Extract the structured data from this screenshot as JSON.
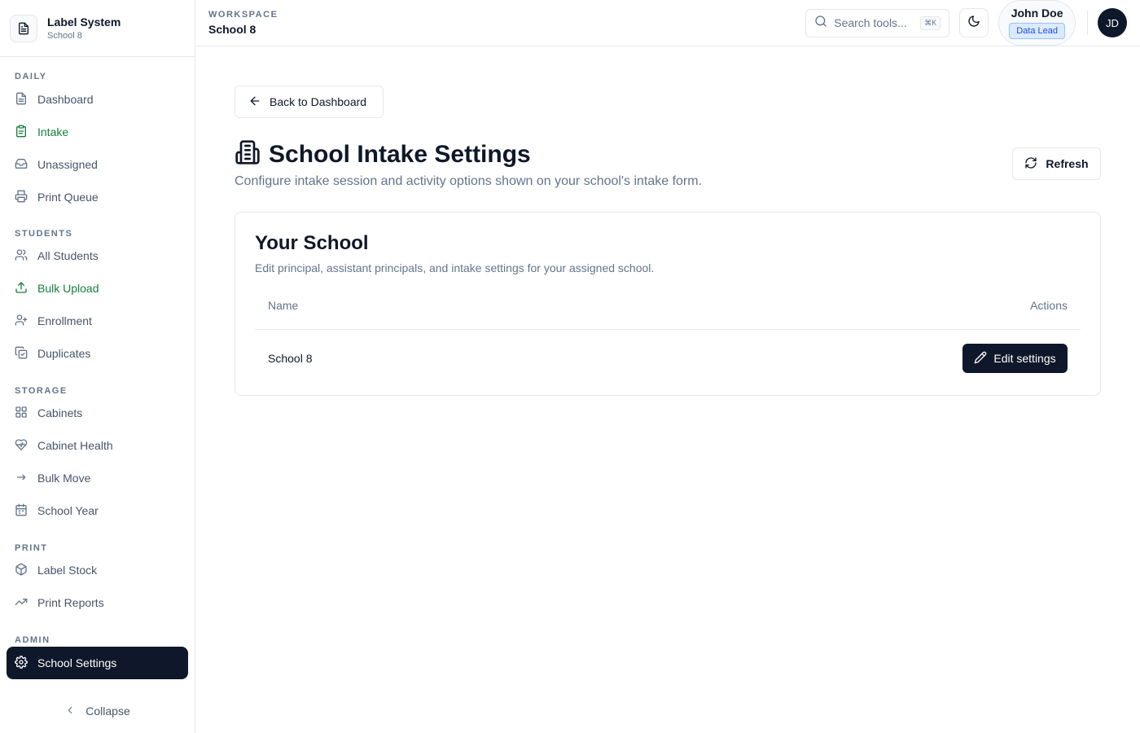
{
  "brand": {
    "title": "Label System",
    "subtitle": "School 8"
  },
  "nav": {
    "sections": [
      {
        "label": "DAILY",
        "items": [
          {
            "label": "Dashboard",
            "icon": "file-icon"
          },
          {
            "label": "Intake",
            "icon": "clipboard-icon"
          },
          {
            "label": "Unassigned",
            "icon": "inbox-icon"
          },
          {
            "label": "Print Queue",
            "icon": "printer-icon"
          }
        ]
      },
      {
        "label": "STUDENTS",
        "items": [
          {
            "label": "All Students",
            "icon": "users-icon"
          },
          {
            "label": "Bulk Upload",
            "icon": "upload-icon"
          },
          {
            "label": "Enrollment",
            "icon": "user-plus-icon"
          },
          {
            "label": "Duplicates",
            "icon": "copy-check-icon"
          }
        ]
      },
      {
        "label": "STORAGE",
        "items": [
          {
            "label": "Cabinets",
            "icon": "grid-icon"
          },
          {
            "label": "Cabinet Health",
            "icon": "heart-pulse-icon"
          },
          {
            "label": "Bulk Move",
            "icon": "arrow-right-icon"
          },
          {
            "label": "School Year",
            "icon": "calendar-icon"
          }
        ]
      },
      {
        "label": "PRINT",
        "items": [
          {
            "label": "Label Stock",
            "icon": "package-icon"
          },
          {
            "label": "Print Reports",
            "icon": "trending-up-icon"
          }
        ]
      },
      {
        "label": "ADMIN",
        "items": [
          {
            "label": "School Settings",
            "icon": "gear-icon"
          }
        ]
      }
    ],
    "collapse_label": "Collapse"
  },
  "topbar": {
    "workspace_label": "WORKSPACE",
    "workspace_name": "School 8",
    "search_placeholder": "Search tools...",
    "search_shortcut": "⌘K",
    "user_name": "John Doe",
    "user_role": "Data Lead",
    "avatar_initials": "JD"
  },
  "page": {
    "back_label": "Back to Dashboard",
    "title": "School Intake Settings",
    "subtitle": "Configure intake session and activity options shown on your school's intake form.",
    "refresh_label": "Refresh"
  },
  "card": {
    "title": "Your School",
    "description": "Edit principal, assistant principals, and intake settings for your assigned school.",
    "columns": {
      "name": "Name",
      "actions": "Actions"
    },
    "rows": [
      {
        "name": "School 8",
        "action_label": "Edit settings"
      }
    ]
  },
  "colors": {
    "primary": "#0f172a",
    "accent_green": "#15803d",
    "muted": "#64748b",
    "border": "#e5e7eb"
  }
}
